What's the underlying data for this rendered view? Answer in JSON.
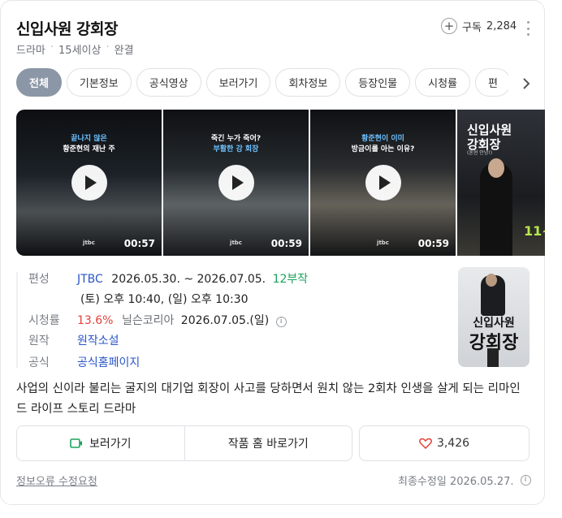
{
  "header": {
    "title": "신입사원 강회장",
    "meta": [
      "드라마",
      "15세이상",
      "완결"
    ],
    "subscribe_label": "구독",
    "subscribe_count": "2,284"
  },
  "tabs": [
    {
      "label": "전체",
      "active": true
    },
    {
      "label": "기본정보"
    },
    {
      "label": "공식영상"
    },
    {
      "label": "보러가기"
    },
    {
      "label": "회차정보"
    },
    {
      "label": "등장인물"
    },
    {
      "label": "시청률"
    },
    {
      "label": "편"
    }
  ],
  "videos": [
    {
      "caption_line1": "끝나지 않은",
      "caption_line2": "황준현의 재난 주",
      "channel": "jtbc",
      "duration": "00:57"
    },
    {
      "caption_line1": "죽긴 누가 죽어?",
      "caption_line2": "부활한 강 회장",
      "channel": "jtbc",
      "duration": "00:59"
    },
    {
      "caption_line1": "황준현이 이미",
      "caption_line2": "방금이를 아는 이유?",
      "channel": "jtbc",
      "duration": "00:59"
    }
  ],
  "poster_thumb": {
    "title_line1": "신입사원",
    "title_line2": "강회장",
    "tagline": "(혼현 안녕!)",
    "episode_mark": "11~"
  },
  "info": {
    "broadcast_label": "편성",
    "channel": "JTBC",
    "period": "2026.05.30. ~ 2026.07.05.",
    "episodes": "12부작",
    "schedule": "(토) 오후 10:40, (일) 오후 10:30",
    "rating_label": "시청률",
    "rating_value": "13.6%",
    "rating_source": "닐슨코리아",
    "rating_date": "2026.07.05.(일)",
    "original_label": "원작",
    "original_value": "원작소설",
    "official_label": "공식",
    "official_value": "공식홈페이지"
  },
  "poster": {
    "title_line1": "신입사원",
    "title_line2": "강회장"
  },
  "description": "사업의 신이라 불리는 굴지의 대기업 회장이 사고를 당하면서 원치 않는 2회차 인생을 살게 되는 리마인드 라이프 스토리 드라마",
  "actions": {
    "watch_label": "보러가기",
    "home_label": "작품 홈 바로가기",
    "like_count": "3,426"
  },
  "footer": {
    "report_label": "정보오류 수정요청",
    "updated_label": "최종수정일 2026.05.27."
  },
  "colors": {
    "accent_green": "#1aa35a",
    "link_blue": "#2a55c9",
    "rating_red": "#e3423a",
    "active_tab": "#8b97a6"
  },
  "icons": {
    "subscribe": "plus-circle-icon",
    "more": "kebab-icon",
    "tab_next": "chevron-right-icon",
    "play": "play-icon",
    "info": "info-icon",
    "watch": "tv-icon",
    "like": "heart-icon"
  }
}
